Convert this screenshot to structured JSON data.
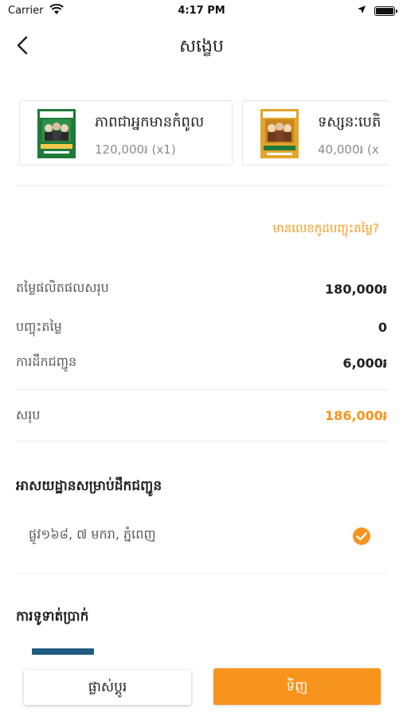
{
  "status_bar": {
    "carrier": "Carrier",
    "time": "4:17 PM"
  },
  "nav": {
    "title": "សង្ខេប"
  },
  "books": [
    {
      "title": "ភាពជាអ្នកមានកំពូល",
      "price": "120,000៛ (x1)"
    },
    {
      "title": "ទស្សនៈបេតិ",
      "price": "40,000៛ (x"
    }
  ],
  "coupon_link": "មានលេខកូដបញ្ចុះតម្លៃ?",
  "summary": {
    "subtotal_label": "តម្លៃផលិតផលសរុប",
    "subtotal_value": "180,000៛",
    "discount_label": "បញ្ចុះតម្លៃ",
    "discount_value": "0",
    "shipping_label": "ការដឹកជញ្ជូន",
    "shipping_value": "6,000៛",
    "total_label": "សរុប",
    "total_value": "186,000៛"
  },
  "shipping_address": {
    "heading": "អាសយដ្ឋានសម្រាប់ដឹកជញ្ជូន",
    "address": "ផ្លូវ១៦៨, ៧ មករា, ភ្នំពេញ"
  },
  "payment": {
    "heading": "ការទូទាត់ប្រាក់"
  },
  "actions": {
    "change_label": "ផ្លាស់ប្តូរ",
    "buy_label": "ទិញ"
  },
  "colors": {
    "accent": "#f7941d",
    "text": "#222222",
    "muted": "#8d8d8d"
  }
}
